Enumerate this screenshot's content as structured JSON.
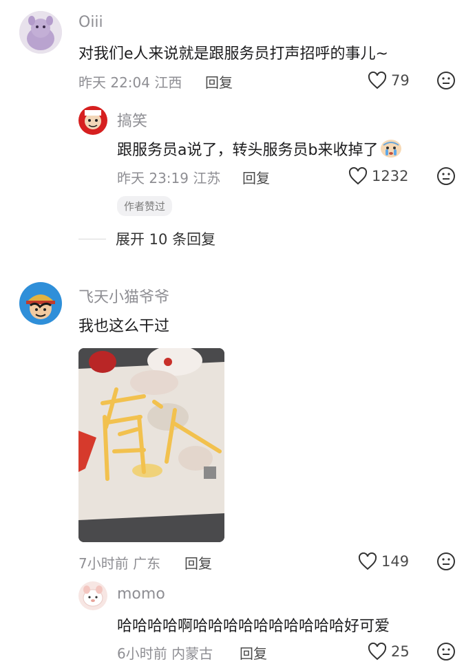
{
  "comments": [
    {
      "username": "Oiii",
      "content": "对我们e人来说就是跟服务员打声招呼的事儿~",
      "time": "昨天 22:04",
      "location": "江西",
      "reply_label": "回复",
      "likes": "79",
      "replies": [
        {
          "username": "搞笑",
          "content": "跟服务员a说了，转头服务员b来收掉了",
          "emoji": "crying-face",
          "time": "昨天 23:19",
          "location": "江苏",
          "reply_label": "回复",
          "likes": "1232",
          "badge": "作者赞过"
        }
      ],
      "expand_label": "展开 10 条回复"
    },
    {
      "username": "飞天小猫爷爷",
      "content": "我也这么干过",
      "time": "7小时前",
      "location": "广东",
      "reply_label": "回复",
      "likes": "149",
      "image": {
        "text_on_fries": "有人"
      },
      "replies": [
        {
          "username": "momo",
          "content": "哈哈哈哈啊哈哈哈哈哈哈哈哈哈哈好可爱",
          "time": "6小时前",
          "location": "内蒙古",
          "reply_label": "回复",
          "likes": "25"
        }
      ]
    }
  ],
  "icons": {
    "like": "heart-outline-icon",
    "dislike": "neutral-face-icon"
  },
  "colors": {
    "muted": "#8e8e93",
    "text": "#1c1c1e"
  }
}
